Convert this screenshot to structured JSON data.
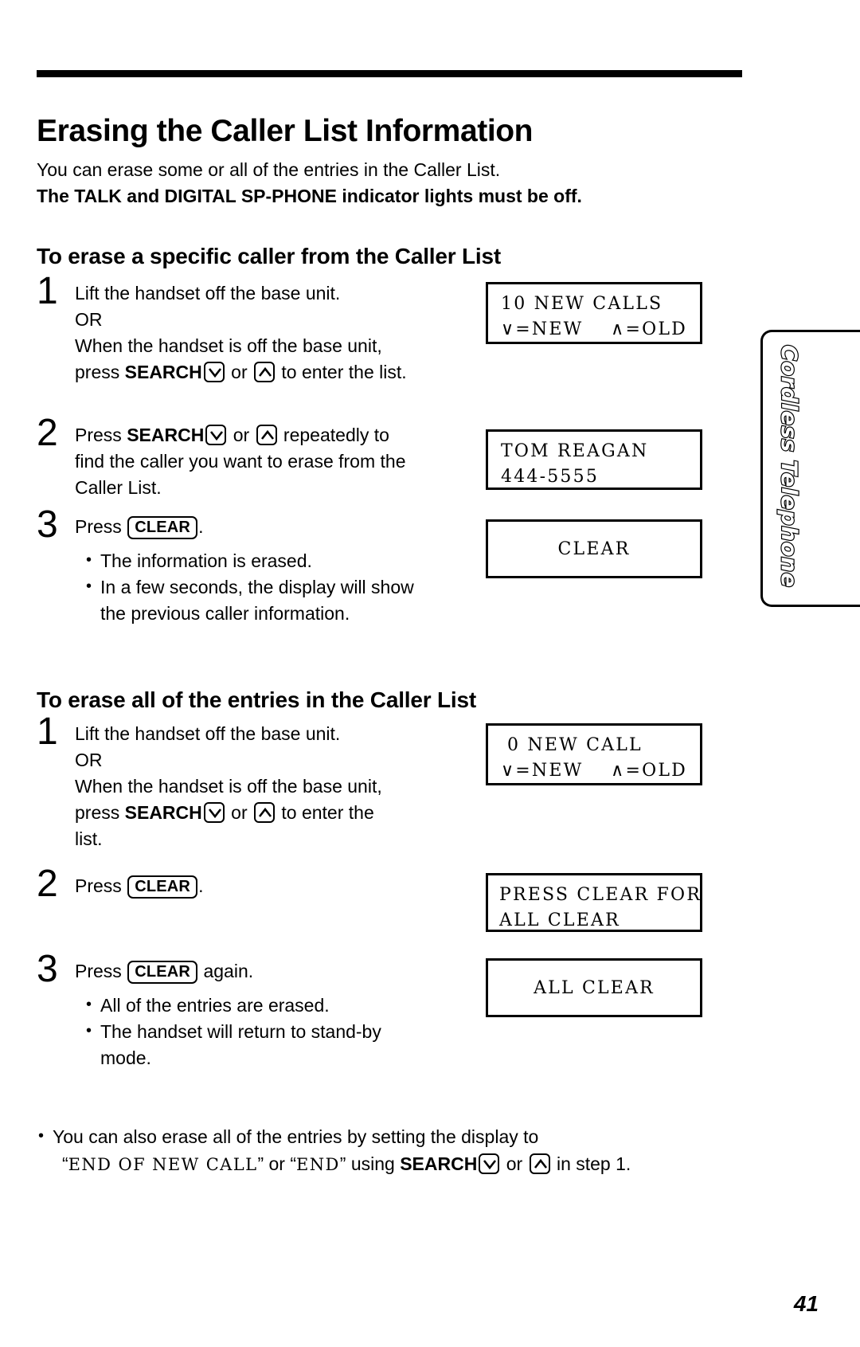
{
  "page": {
    "title": "Erasing the Caller List Information",
    "intro_line_1": "You can erase some or all of the entries in the Caller List.",
    "intro_line_2": "The TALK and DIGITAL SP-PHONE indicator lights must be off.",
    "page_number": "41",
    "side_tab_label": "Cordless Telephone"
  },
  "section1": {
    "title": "To erase a specific caller from the Caller List",
    "steps": [
      {
        "num": "1",
        "l1": "Lift the handset off the base unit.",
        "l2": "OR",
        "l3": "When the handset is off the base unit,",
        "l4_pre": "press ",
        "l4_bold": "SEARCH",
        "l4_mid": " or ",
        "l4_post": " to enter the list."
      },
      {
        "num": "2",
        "l1_pre": "Press ",
        "l1_bold": "SEARCH",
        "l1_mid": " or ",
        "l1_post": " repeatedly to",
        "l2": "find the caller you want to erase from the",
        "l3": "Caller List."
      },
      {
        "num": "3",
        "l1_pre": "Press ",
        "l1_key": "CLEAR",
        "l1_post": ".",
        "bullets": [
          "The information is erased.",
          "In a few seconds, the display will show",
          "the previous caller information."
        ]
      }
    ],
    "displays": [
      {
        "row1": "10 NEW CALLS",
        "row2_left": "∨=NEW",
        "row2_right": "∧=OLD"
      },
      {
        "row1": "TOM REAGAN",
        "row2_left": "444-5555",
        "row2_right": ""
      },
      {
        "row1_center": "CLEAR"
      }
    ]
  },
  "section2": {
    "title": "To erase all of the entries in the Caller List",
    "steps": [
      {
        "num": "1",
        "l1": "Lift the handset off the base unit.",
        "l2": "OR",
        "l3": "When the handset is off the base unit,",
        "l4_pre": "press ",
        "l4_bold": "SEARCH",
        "l4_mid": " or ",
        "l4_post": " to enter the",
        "l5": "list."
      },
      {
        "num": "2",
        "l1_pre": "Press ",
        "l1_key": "CLEAR",
        "l1_post": "."
      },
      {
        "num": "3",
        "l1_pre": "Press ",
        "l1_key": "CLEAR",
        "l1_post": " again.",
        "bullets": [
          "All of the entries are erased.",
          "The handset will return to stand-by",
          "mode."
        ]
      }
    ],
    "displays": [
      {
        "row1": "0 NEW CALL",
        "row2_left": "∨=NEW",
        "row2_right": "∧=OLD"
      },
      {
        "row1": "PRESS CLEAR FOR",
        "row2_left": "ALL CLEAR",
        "row2_right": ""
      },
      {
        "row1_center": "ALL CLEAR"
      }
    ]
  },
  "footnote": {
    "part1": "You can also erase all of the entries by setting the display to",
    "quote_open": "“",
    "mono1": "END OF NEW CALL",
    "mid1": "” or “",
    "mono2": "END",
    "mid2": "” using ",
    "bold": "SEARCH",
    "mid3": " or ",
    "tail": " in step 1."
  },
  "icons": {
    "search_down": "chevron-down-key-icon",
    "search_up": "chevron-up-key-icon"
  }
}
